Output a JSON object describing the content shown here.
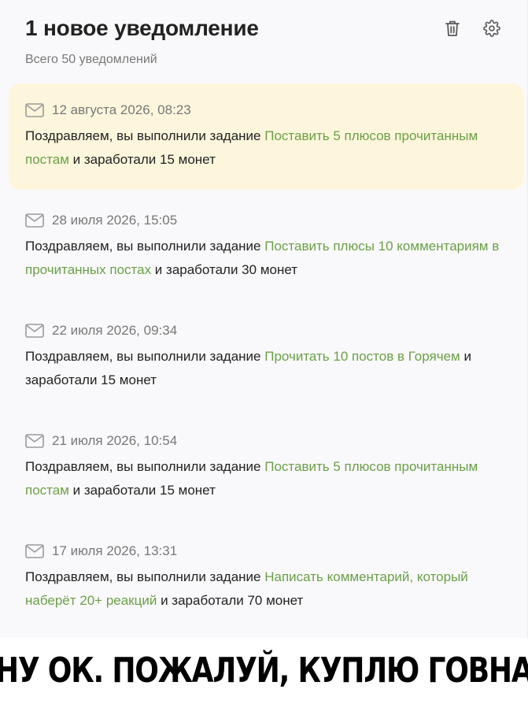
{
  "header": {
    "title": "1 новое уведомление",
    "total": "Всего 50 уведомлений",
    "trash_icon": "trash-icon",
    "settings_icon": "gear-icon"
  },
  "colors": {
    "unread_bg": "#fdf6dc",
    "link": "#6aa046",
    "muted": "#777777"
  },
  "notifications": [
    {
      "date": "12 августа 2026, 08:23",
      "prefix": "Поздравляем, вы выполнили задание ",
      "task": "Поставить 5 плюсов прочитанным постам",
      "suffix": " и заработали 15 монет",
      "unread": true
    },
    {
      "date": "28 июля 2026, 15:05",
      "prefix": "Поздравляем, вы выполнили задание ",
      "task": "Поставить плюсы 10 комментариям в прочитанных постах",
      "suffix": " и заработали 30 монет",
      "unread": false
    },
    {
      "date": "22 июля 2026, 09:34",
      "prefix": "Поздравляем, вы выполнили задание ",
      "task": "Прочитать 10 постов в Горячем",
      "suffix": " и заработали 15 монет",
      "unread": false
    },
    {
      "date": "21 июля 2026, 10:54",
      "prefix": "Поздравляем, вы выполнили задание ",
      "task": "Поставить 5 плюсов прочитанным постам",
      "suffix": " и заработали 15 монет",
      "unread": false
    },
    {
      "date": "17 июля 2026, 13:31",
      "prefix": "Поздравляем, вы выполнили задание ",
      "task": "Написать комментарий, который наберёт 20+ реакций",
      "suffix": " и заработали 70 монет",
      "unread": false
    }
  ],
  "caption": "НУ ОК. ПОЖАЛУЙ, КУПЛЮ ГОВНА"
}
